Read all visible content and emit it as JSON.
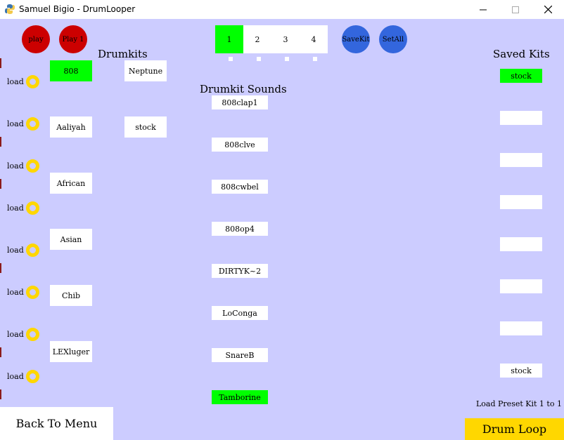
{
  "window": {
    "title": "Samuel Bigio - DrumLooper",
    "icon": "python-icon"
  },
  "controls": {
    "play": "play",
    "play1": "Play 1",
    "save_kit": "SaveKit",
    "set_all": "SetAll"
  },
  "tabs": [
    "1",
    "2",
    "3",
    "4"
  ],
  "active_tab": "1",
  "headings": {
    "drumkits": "Drumkits",
    "sounds": "Drumkit Sounds",
    "saved": "Saved Kits"
  },
  "load_label": "load",
  "drumkits_col1": [
    "808",
    "Aaliyah",
    "African",
    "Asian",
    "Chib",
    "LEXluger"
  ],
  "drumkits_col2": [
    "Neptune",
    "stock"
  ],
  "sounds": [
    "808clap1",
    "808clve",
    "808cwbel",
    "808op4",
    "DIRTYK~2",
    "LoConga",
    "SnareB",
    "Tamborine"
  ],
  "saved_kits": [
    "stock",
    "",
    "",
    "",
    "",
    "",
    "",
    "stock"
  ],
  "preset_label": "Load Preset Kit 1 to 1",
  "back_to_menu": "Back To Menu",
  "drum_loop": "Drum Loop",
  "colors": {
    "background": "#ccccff",
    "selected": "#00ff00",
    "play_button": "#cc0000",
    "action_button": "#3366dd",
    "load_ring": "#ffd700",
    "drum_loop": "#ffd700"
  }
}
